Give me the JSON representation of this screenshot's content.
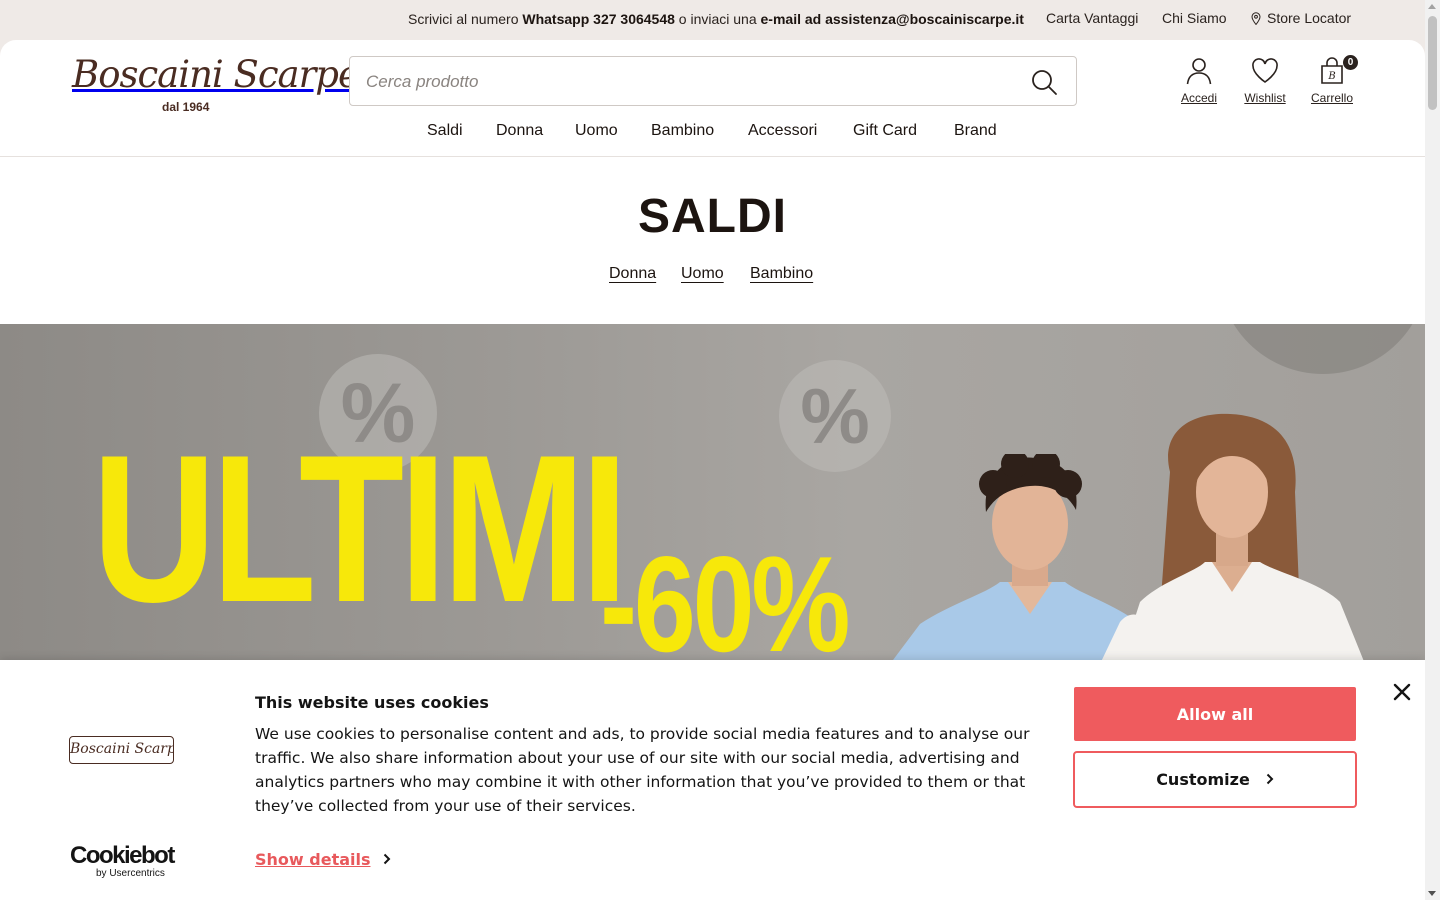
{
  "topbar": {
    "msg_prefix": "Scrivici al numero ",
    "whatsapp": "Whatsapp 327 3064548",
    "msg_mid": " o inviaci una ",
    "email": "e-mail ad assistenza@boscainiscarpe.it",
    "carta_vantaggi": "Carta Vantaggi",
    "chi_siamo": "Chi Siamo",
    "store_locator": "Store Locator"
  },
  "header": {
    "logo_text": "Boscaini Scarpe",
    "logo_since": "dal 1964",
    "search_placeholder": "Cerca prodotto",
    "account_label": "Accedi",
    "wishlist_label": "Wishlist",
    "cart_label": "Carrello",
    "cart_count": "0"
  },
  "nav": {
    "items": [
      "Saldi",
      "Donna",
      "Uomo",
      "Bambino",
      "Accessori",
      "Gift Card",
      "Brand"
    ]
  },
  "page": {
    "title": "SALDI",
    "subnav": [
      "Donna",
      "Uomo",
      "Bambino"
    ]
  },
  "banner": {
    "headline": "ULTIMI",
    "discount": "-60%",
    "percent_symbol": "%"
  },
  "cookie": {
    "logo_text": "Boscaini Scarpe",
    "title": "This website uses cookies",
    "text": "We use cookies to personalise content and ads, to provide social media features and to analyse our traffic. We also share information about your use of our site with our social media, advertising and analytics partners who may combine it with other information that you’ve provided to them or that they’ve collected from your use of their services.",
    "show_details": "Show details",
    "allow_all": "Allow all",
    "customize": "Customize",
    "provider": "Cookiebot",
    "provider_by": "by Usercentrics"
  },
  "colors": {
    "brand": "#4a2c22",
    "banner_yellow": "#f7e80a",
    "cookie_accent": "#ef5b5e"
  }
}
